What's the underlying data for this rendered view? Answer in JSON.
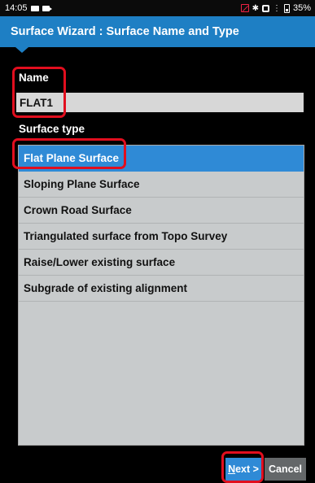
{
  "status_bar": {
    "time": "14:05",
    "battery": "35%",
    "icons": [
      "notification-box-icon",
      "video-icon",
      "no-sim-icon",
      "bluetooth-icon",
      "vibrate-icon",
      "wifi-icon",
      "battery-icon"
    ]
  },
  "header": {
    "title": "Surface Wizard : Surface Name and Type"
  },
  "form": {
    "name_label": "Name",
    "name_value": "FLAT1",
    "type_label": "Surface type",
    "surface_types": [
      "Flat Plane Surface",
      "Sloping Plane Surface",
      "Crown Road Surface",
      "Triangulated surface from Topo Survey",
      "Raise/Lower existing surface",
      "Subgrade of existing alignment"
    ],
    "selected_index": 0
  },
  "footer": {
    "next_label_underlined": "N",
    "next_label_rest": "ext >",
    "cancel_label": "Cancel"
  },
  "colors": {
    "accent": "#1e7fc4",
    "selected": "#2f8ad6",
    "highlight": "#e10e1e"
  }
}
